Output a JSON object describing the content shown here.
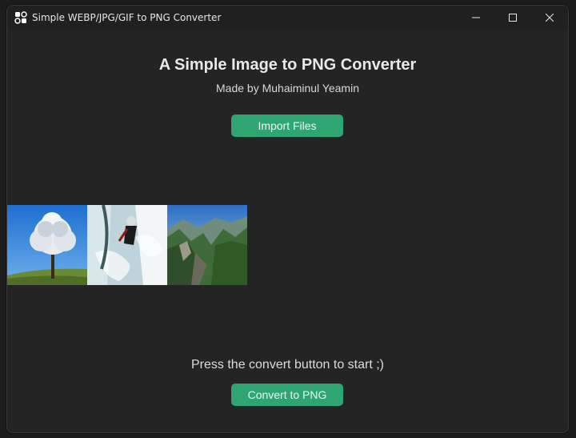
{
  "window": {
    "title": "Simple WEBP/JPG/GIF to PNG Converter"
  },
  "main": {
    "heading": "A Simple Image to PNG Converter",
    "subheading": "Made by Muhaiminul Yeamin",
    "import_label": "Import Files",
    "status_text": "Press the convert button to start ;)",
    "convert_label": "Convert to PNG"
  },
  "thumbnails": [
    {
      "name": "tree"
    },
    {
      "name": "waterfall-climber"
    },
    {
      "name": "mountain-valley"
    }
  ],
  "colors": {
    "accent": "#2fa572",
    "background": "#242424",
    "titlebar": "#202020"
  }
}
